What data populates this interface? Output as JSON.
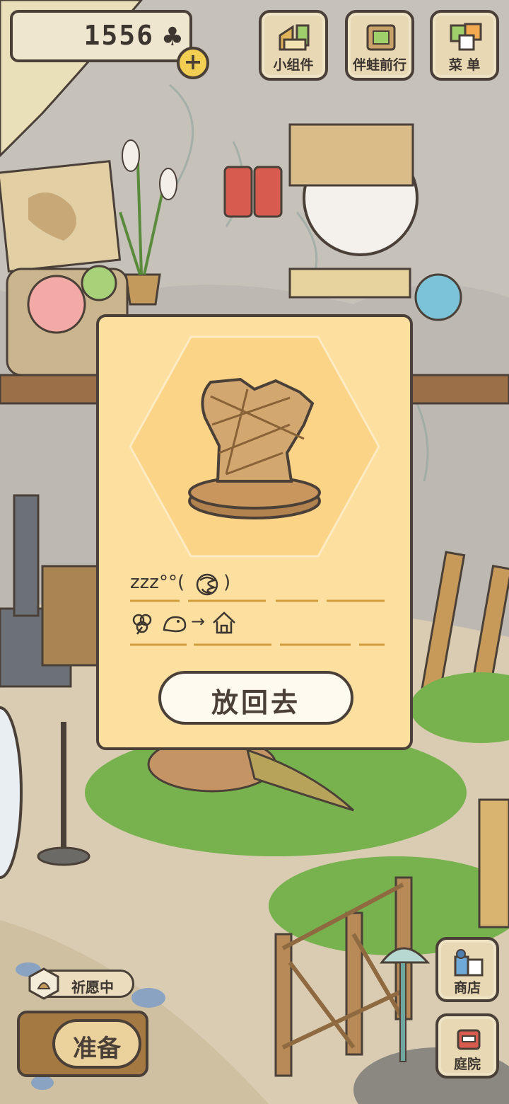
{
  "top_bar": {
    "clover_count": "1556",
    "clover_symbol": "♣",
    "plus_symbol": "+",
    "buttons": [
      {
        "label": "小组件",
        "icon": "widget-icon"
      },
      {
        "label": "伴蛙前行",
        "icon": "frog-journey-icon"
      },
      {
        "label": "菜 单",
        "icon": "menu-icon"
      }
    ]
  },
  "side_buttons": [
    {
      "label": "商店",
      "icon": "shop-bag-icon"
    },
    {
      "label": "庭院",
      "icon": "garden-mailbox-icon"
    }
  ],
  "bottom_left": {
    "pray_label": "祈愿中",
    "ready_label": "准备"
  },
  "dialog": {
    "item_icon": "wooden-frog-statue-icon",
    "sleep_text": "zzz°°(",
    "sleep_close": ")",
    "route_arrow": "→",
    "put_back_label": "放回去"
  },
  "colors": {
    "dialog_bg": "#fde0a0",
    "hex_bg": "#fcd487",
    "outline": "#4a4038",
    "grass": "#78b24e"
  }
}
